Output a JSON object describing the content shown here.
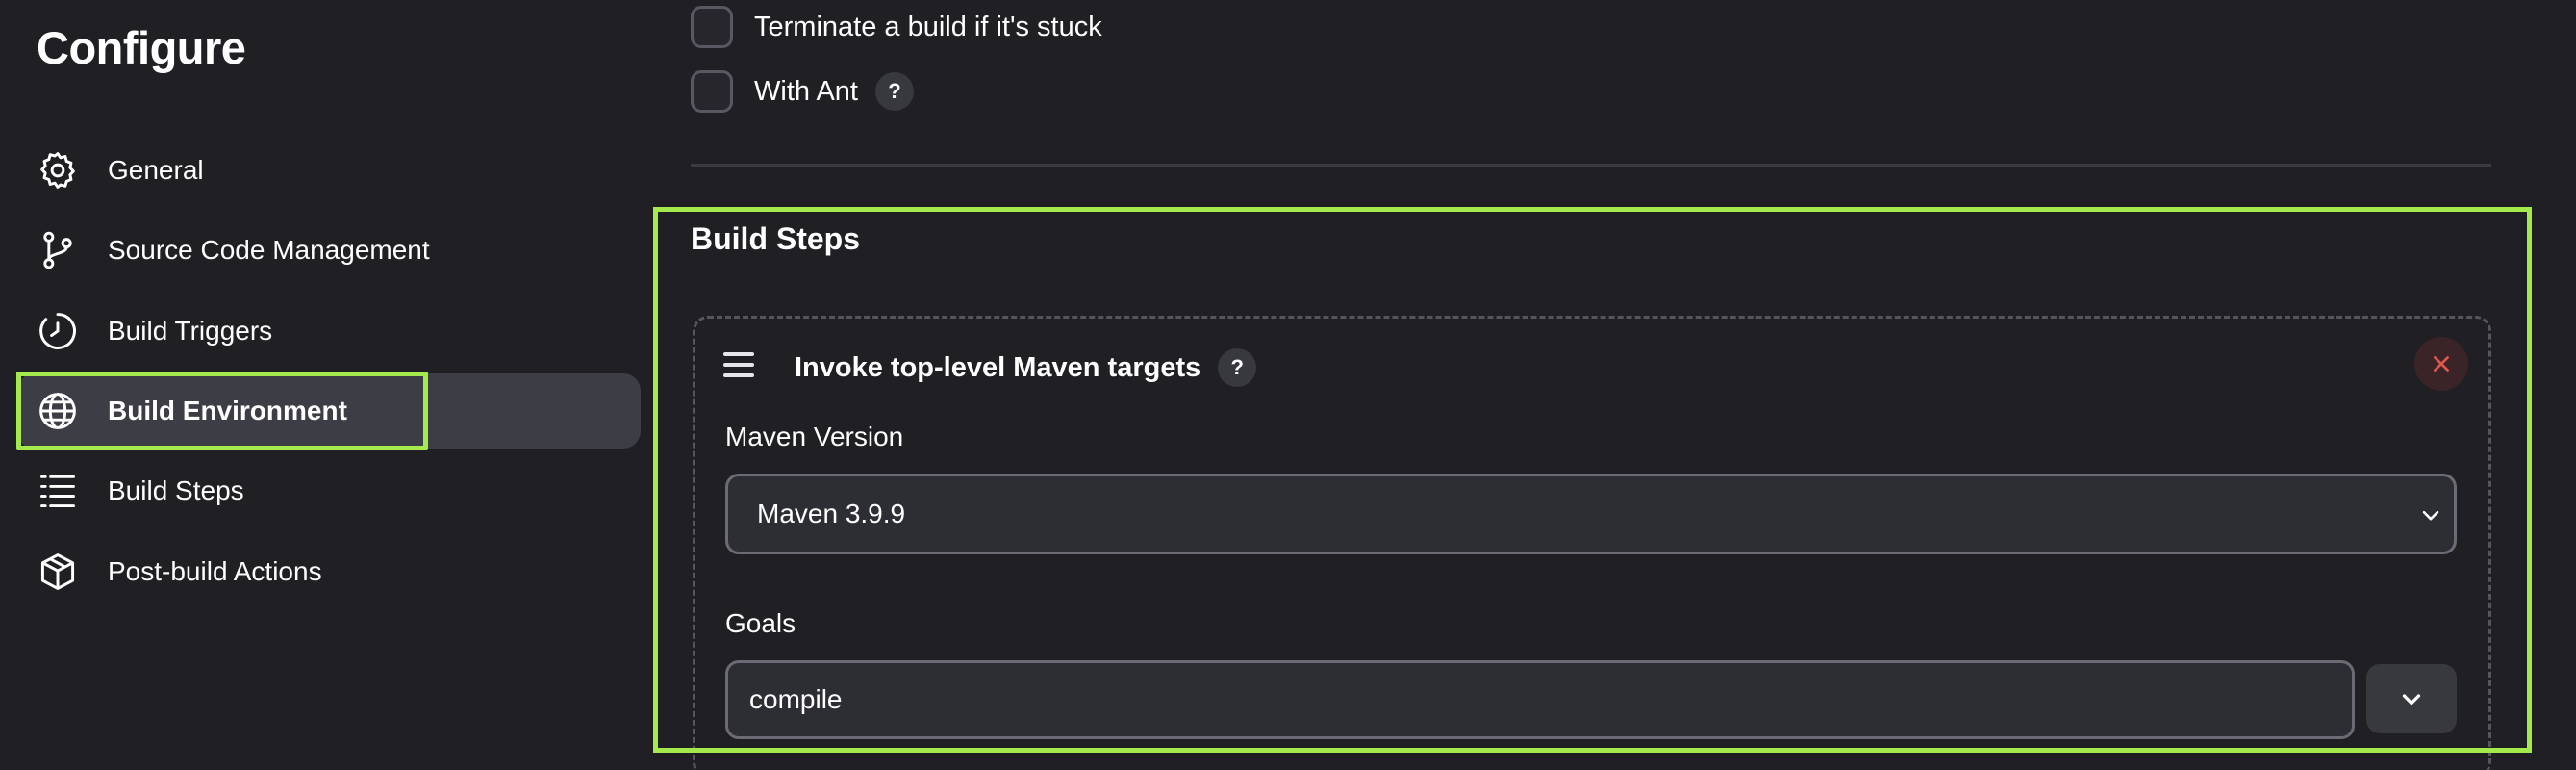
{
  "sidebar": {
    "title": "Configure",
    "items": [
      {
        "label": "General",
        "icon": "gear-icon"
      },
      {
        "label": "Source Code Management",
        "icon": "branch-icon"
      },
      {
        "label": "Build Triggers",
        "icon": "clock-icon"
      },
      {
        "label": "Build Environment",
        "icon": "globe-icon",
        "active": true
      },
      {
        "label": "Build Steps",
        "icon": "list-icon"
      },
      {
        "label": "Post-build Actions",
        "icon": "package-icon"
      }
    ]
  },
  "options": {
    "terminate_label": "Terminate a build if it's stuck",
    "ant_label": "With Ant",
    "help": "?"
  },
  "build_steps": {
    "title": "Build Steps",
    "step": {
      "title": "Invoke top-level Maven targets",
      "help": "?",
      "maven_version_label": "Maven Version",
      "maven_version_value": "Maven 3.9.9",
      "goals_label": "Goals",
      "goals_value": "compile"
    }
  },
  "colors": {
    "highlight": "#a4ea4c",
    "background": "#1f1f24",
    "active_nav": "#3d3d45",
    "danger": "#e2574c"
  }
}
